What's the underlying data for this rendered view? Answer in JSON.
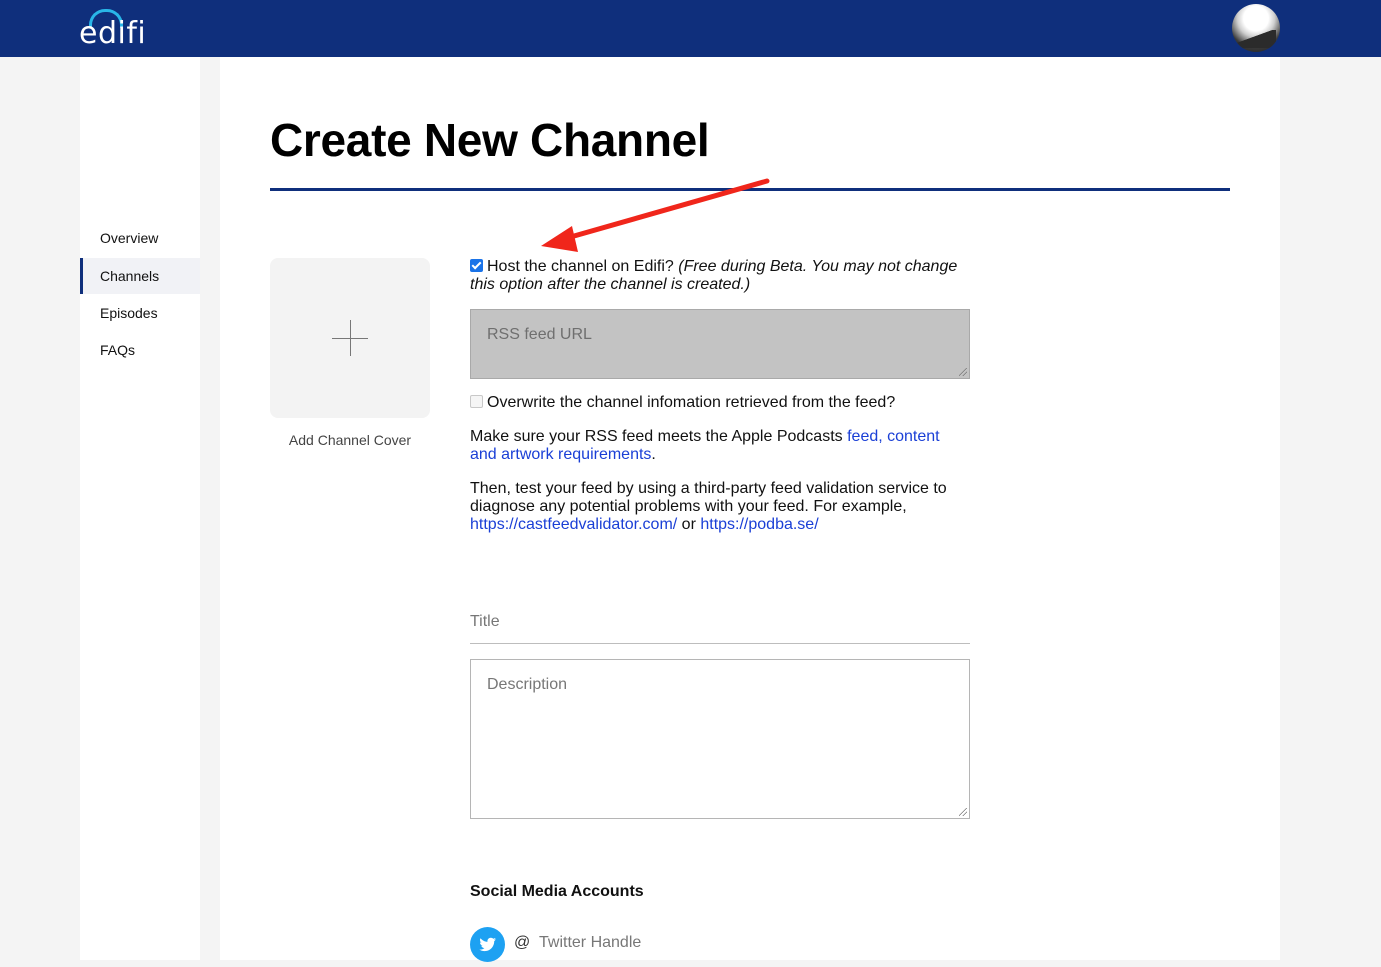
{
  "header": {
    "logo_text": "edifi",
    "brand_color": "#0f2f7c",
    "accent_color": "#29b6e8"
  },
  "sidebar": {
    "items": [
      {
        "label": "Overview",
        "active": false
      },
      {
        "label": "Channels",
        "active": true
      },
      {
        "label": "Episodes",
        "active": false
      },
      {
        "label": "FAQs",
        "active": false
      }
    ]
  },
  "page": {
    "title": "Create New Channel"
  },
  "cover": {
    "label": "Add Channel Cover"
  },
  "form": {
    "host_checkbox": {
      "checked": true,
      "label": "Host the channel on Edifi?",
      "note": "(Free during Beta. You may not change this option after the channel is created.)"
    },
    "rss_placeholder": "RSS feed URL",
    "overwrite_checkbox": {
      "checked": false,
      "label": "Overwrite the channel infomation retrieved from the feed?"
    },
    "requirements": {
      "text": "Make sure your RSS feed meets the Apple Podcasts ",
      "link": "feed, content and artwork requirements",
      "end": "."
    },
    "validation": {
      "text": "Then, test your feed by using a third-party feed validation service to diagnose any potential problems with your feed. For example, ",
      "link1": "https://castfeedvalidator.com/",
      "or": " or ",
      "link2": "https://podba.se/"
    },
    "title_placeholder": "Title",
    "description_placeholder": "Description",
    "social_heading": "Social Media Accounts",
    "twitter": {
      "at": "@",
      "placeholder": "Twitter Handle"
    }
  },
  "annotation": {
    "arrow_color": "#f0261b"
  }
}
